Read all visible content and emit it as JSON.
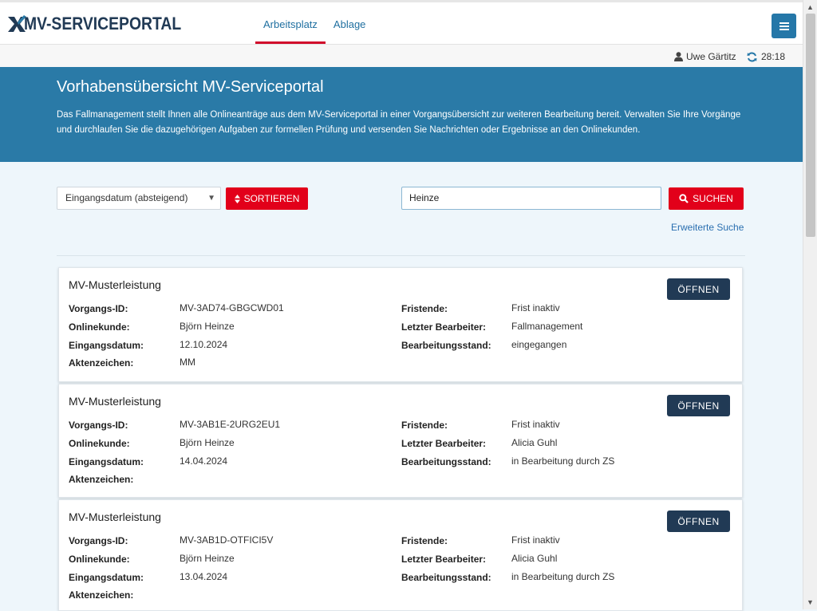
{
  "header": {
    "logo_text": "MV-SERVICEPORTAL",
    "nav": [
      {
        "label": "Arbeitsplatz",
        "active": true
      },
      {
        "label": "Ablage",
        "active": false
      }
    ],
    "menu_icon": "hamburger-icon"
  },
  "userbar": {
    "user_name": "Uwe Gärtitz",
    "user_icon": "user-icon",
    "timer": "28:18",
    "timer_icon": "refresh-icon"
  },
  "hero": {
    "title": "Vorhabensübersicht MV-Serviceportal",
    "description": "Das Fallmanagement stellt Ihnen alle Onlineanträge aus dem MV-Serviceportal in einer Vorgangsübersicht zur weiteren Bearbeitung bereit. Verwalten Sie Ihre Vorgänge und durchlaufen Sie die dazugehörigen Aufgaben zur formellen Prüfung und versenden Sie Nachrichten oder Ergebnisse an den Onlinekunden."
  },
  "controls": {
    "sort_value": "Eingangsdatum (absteigend)",
    "sort_button": "SORTIEREN",
    "search_value": "Heinze",
    "search_button": "SUCHEN",
    "advanced_search": "Erweiterte Suche"
  },
  "labels": {
    "vorgangs_id": "Vorgangs-ID:",
    "onlinekunde": "Onlinekunde:",
    "eingangsdatum": "Eingangsdatum:",
    "aktenzeichen": "Aktenzeichen:",
    "fristende": "Fristende:",
    "letzter_bearbeiter": "Letzter Bearbeiter:",
    "bearbeitungsstand": "Bearbeitungsstand:",
    "open_button": "ÖFFNEN"
  },
  "cards": [
    {
      "title": "MV-Musterleistung",
      "vorgangs_id": "MV-3AD74-GBGCWD01",
      "onlinekunde": "Björn Heinze",
      "eingangsdatum": "12.10.2024",
      "aktenzeichen": "MM",
      "fristende": "Frist inaktiv",
      "letzter_bearbeiter": "Fallmanagement",
      "bearbeitungsstand": "eingegangen"
    },
    {
      "title": "MV-Musterleistung",
      "vorgangs_id": "MV-3AB1E-2URG2EU1",
      "onlinekunde": "Björn Heinze",
      "eingangsdatum": "14.04.2024",
      "aktenzeichen": "",
      "fristende": "Frist inaktiv",
      "letzter_bearbeiter": "Alicia Guhl",
      "bearbeitungsstand": "in Bearbeitung durch ZS"
    },
    {
      "title": "MV-Musterleistung",
      "vorgangs_id": "MV-3AB1D-OTFICI5V",
      "onlinekunde": "Björn Heinze",
      "eingangsdatum": "13.04.2024",
      "aktenzeichen": "",
      "fristende": "Frist inaktiv",
      "letzter_bearbeiter": "Alicia Guhl",
      "bearbeitungsstand": "in Bearbeitung durch ZS"
    }
  ]
}
